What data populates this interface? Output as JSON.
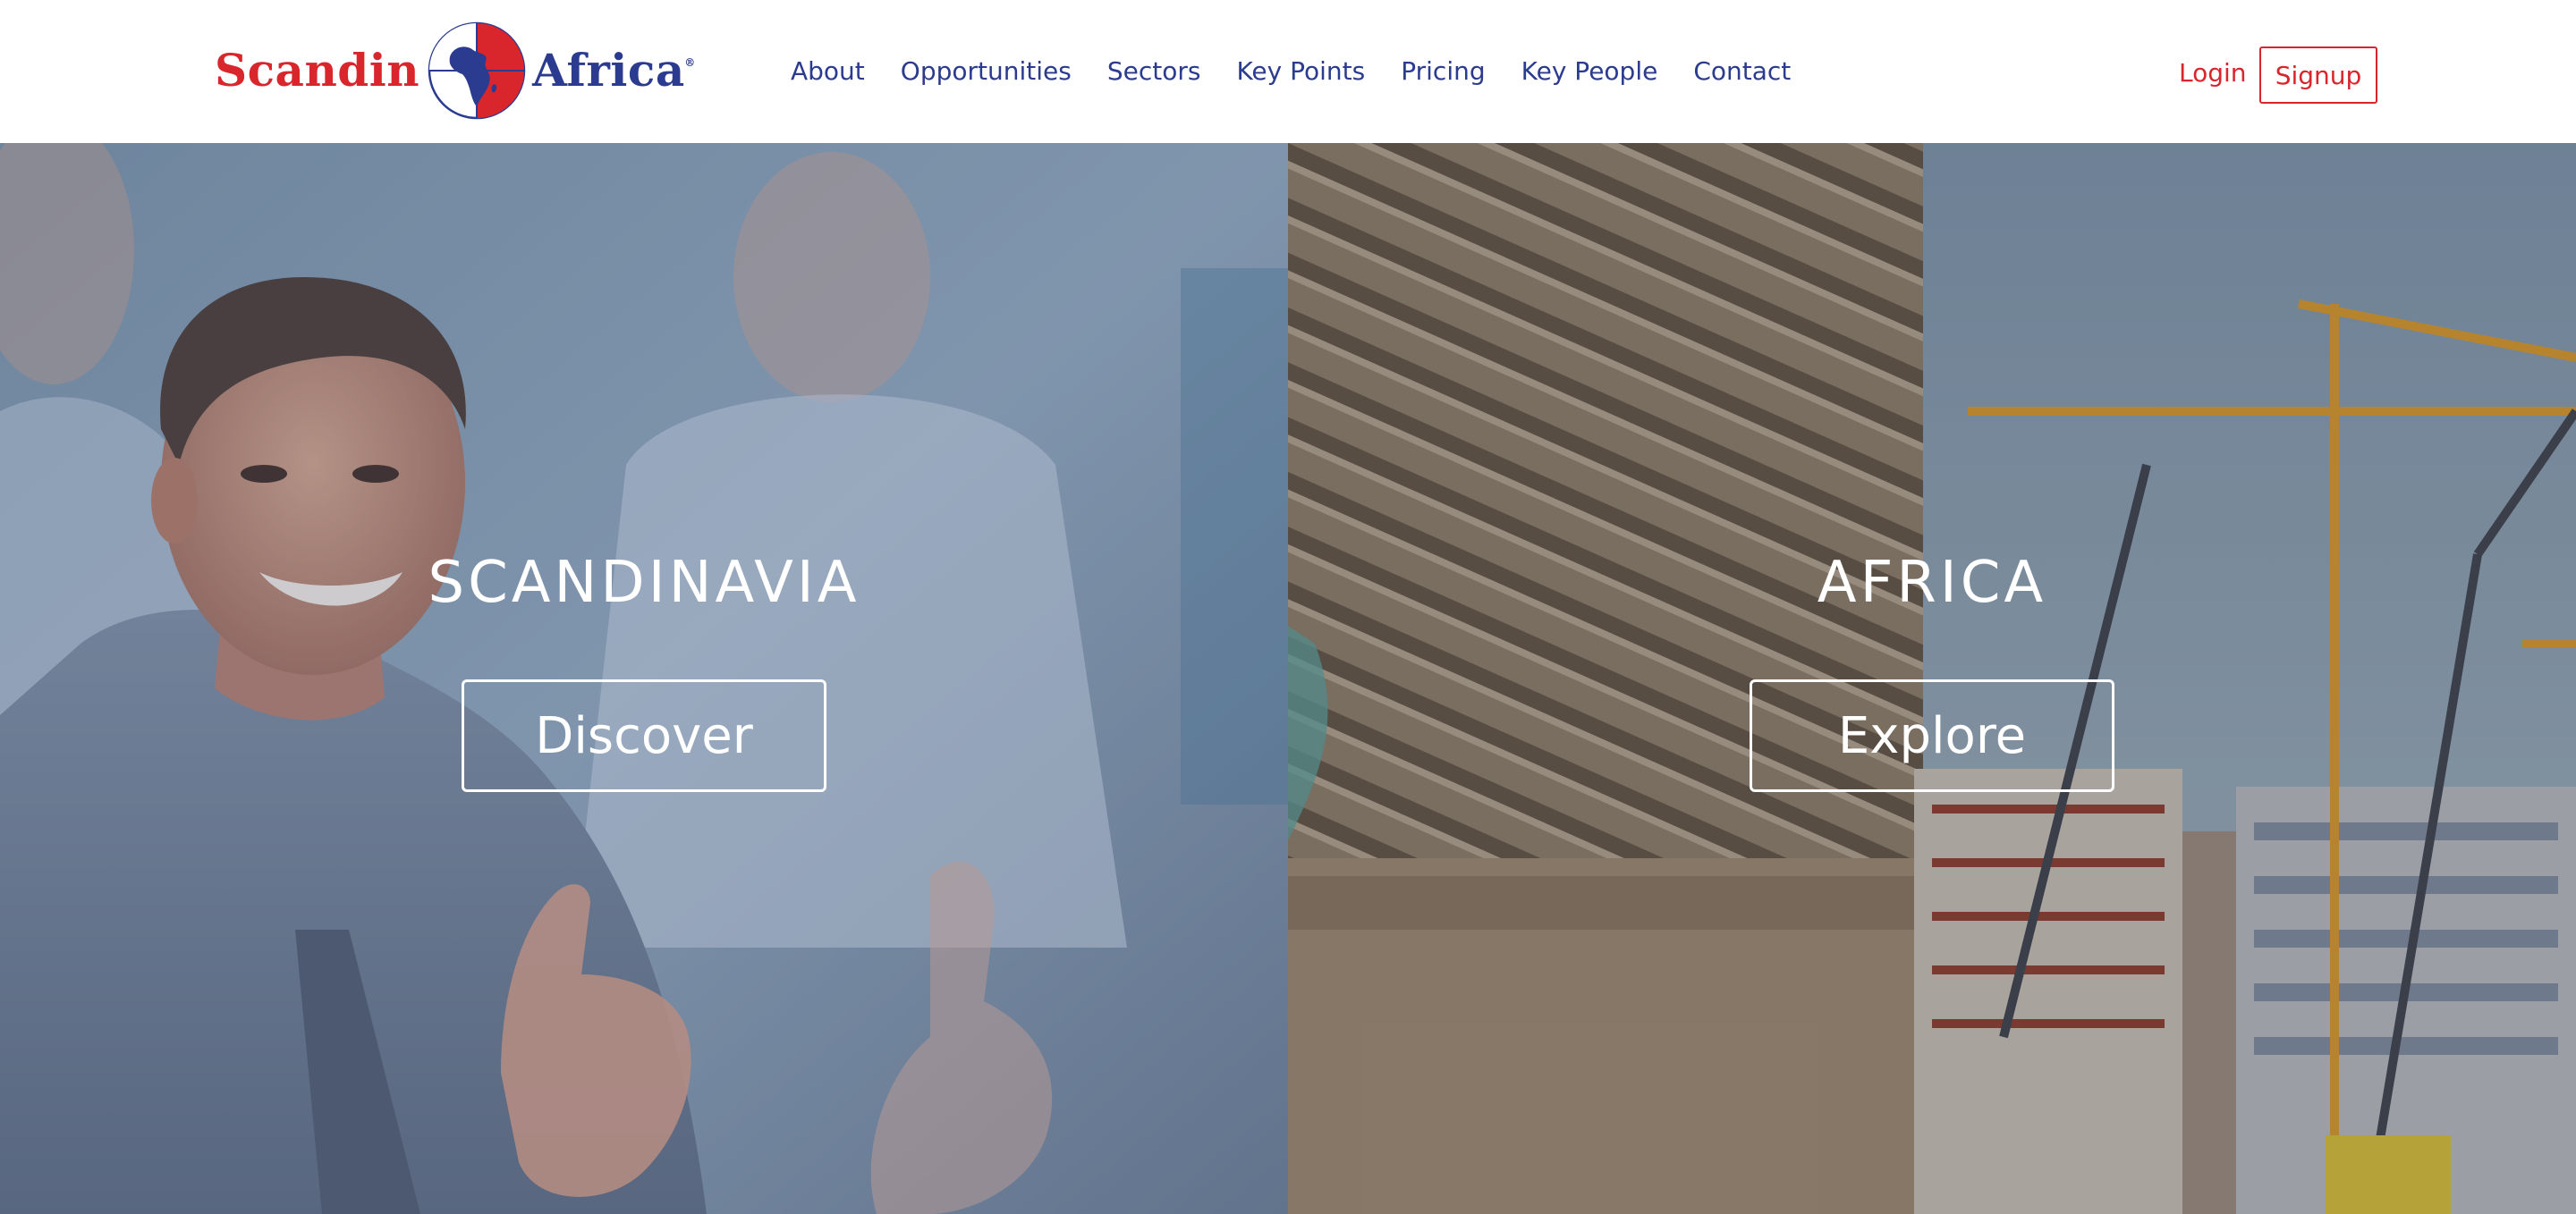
{
  "brand": {
    "name_left": "Scandin",
    "name_right": "Africa",
    "red": "#d9262c",
    "blue": "#2b3b8f"
  },
  "nav": {
    "items": [
      {
        "label": "About"
      },
      {
        "label": "Opportunities"
      },
      {
        "label": "Sectors"
      },
      {
        "label": "Key Points"
      },
      {
        "label": "Pricing"
      },
      {
        "label": "Key People"
      },
      {
        "label": "Contact"
      }
    ]
  },
  "auth": {
    "login_label": "Login",
    "signup_label": "Signup"
  },
  "hero": {
    "left": {
      "title": "SCANDINAVIA",
      "button_label": "Discover",
      "image": "businessman-thumbs-up-photo"
    },
    "right": {
      "title": "AFRICA",
      "button_label": "Explore",
      "image": "open-pit-mine-and-construction-cranes-photo"
    }
  }
}
